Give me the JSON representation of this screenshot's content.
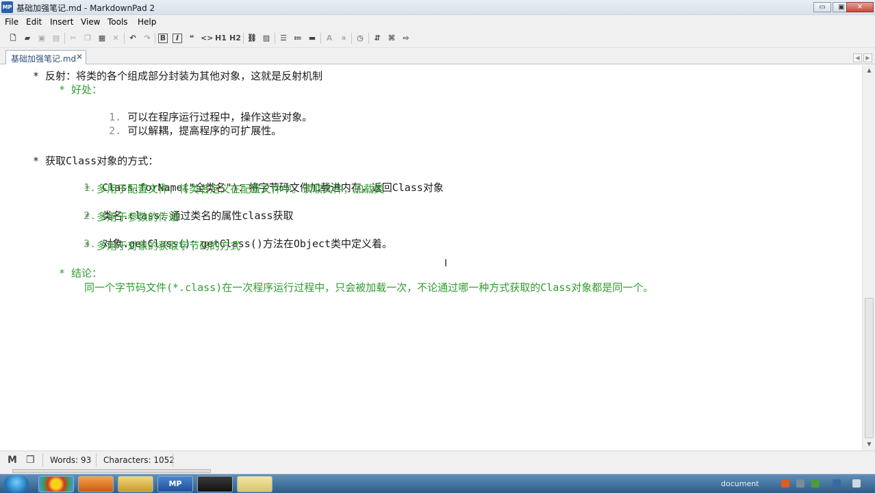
{
  "window": {
    "title": "基础加强笔记.md - MarkdownPad 2",
    "app_icon_text": "MP",
    "buttons": {
      "minimize": "▭",
      "maximize": "▣",
      "close": "✕"
    }
  },
  "menu": [
    "File",
    "Edit",
    "Insert",
    "View",
    "Tools",
    "Help"
  ],
  "toolbar": {
    "icons": [
      "new-file-icon",
      "open-folder-icon",
      "save-icon",
      "save-all-icon",
      "cut-icon",
      "copy-icon",
      "paste-icon",
      "delete-icon",
      "undo-icon",
      "redo-icon",
      "bold-icon",
      "italic-icon",
      "quote-icon",
      "code-icon",
      "h1-icon",
      "h2-icon",
      "link-icon",
      "image-icon",
      "bullet-list-icon",
      "numbered-list-icon",
      "horizontal-rule-icon",
      "font-larger-icon",
      "font-smaller-icon",
      "timestamp-icon",
      "upload-icon",
      "preview-icon",
      "export-icon"
    ],
    "h1": "H1",
    "h2": "H2",
    "big_a": "A",
    "small_a": "a"
  },
  "tab": {
    "label": "基础加强笔记.md",
    "close": "✕"
  },
  "editor": {
    "lines": [
      {
        "text": "* 反射：将类的各个组成部分封装为其他对象，这就是反射机制",
        "color": "black"
      },
      {
        "text": "* 好处：",
        "color": "green"
      },
      {
        "num": "1.",
        "text": "可以在程序运行过程中，操作这些对象。",
        "color": "black"
      },
      {
        "num": "2.",
        "text": "可以解耦，提高程序的可扩展性。",
        "color": "black"
      },
      {
        "text": "* 获取Class对象的方式：",
        "color": "black"
      },
      {
        "num": "1.",
        "text": "Class.forName(\"全类名\")：将字节码文件加载进内存，返回Class对象",
        "color": "black"
      },
      {
        "text": "* 多用于配置文件，将类名定义在配置文件中。读取文件，加载类",
        "color": "green"
      },
      {
        "num": "2.",
        "text": "类名.class：通过类名的属性class获取",
        "color": "black"
      },
      {
        "text": "* 多用于参数的传递",
        "color": "green"
      },
      {
        "num": "3.",
        "text": "对象.getClass()：getClass()方法在Object类中定义着。",
        "color": "black"
      },
      {
        "text": "* 多用于对象的获取字节码的方式",
        "color": "green"
      },
      {
        "text": "* 结论：",
        "color": "green"
      },
      {
        "text": "同一个字节码文件(*.class)在一次程序运行过程中，只会被加载一次，不论通过哪一种方式获取的Class对象都是同一个。",
        "color": "green"
      }
    ]
  },
  "statusbar": {
    "markdown_icon": "M",
    "words": "Words: 93",
    "characters": "Characters: 1052"
  },
  "taskbar": {
    "items": [
      "chrome-icon",
      "browser-icon",
      "explorer-icon",
      "markdownpad-icon",
      "intellij-icon",
      "notepad-icon"
    ],
    "mp_label": "MP",
    "tray_text": "document"
  },
  "colors": {
    "text_green": "#2f9d2f",
    "text_black": "#1b1b1b",
    "list_number_gray": "#8c8c8c"
  }
}
